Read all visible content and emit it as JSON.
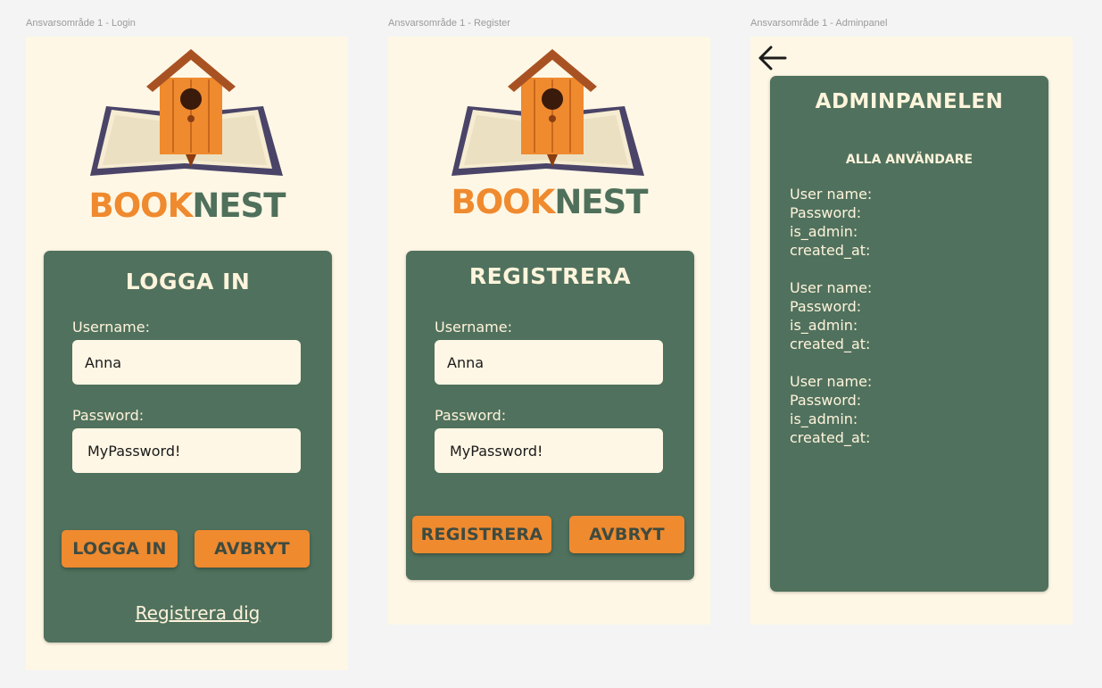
{
  "frames": {
    "login": {
      "label": "Ansvarsområde 1 - Login"
    },
    "register": {
      "label": "Ansvarsområde 1 - Register"
    },
    "admin": {
      "label": "Ansvarsområde 1 - Adminpanel"
    }
  },
  "brand": {
    "part1": "BOOK",
    "part2": "NEST"
  },
  "colors": {
    "background": "#f4f4f4",
    "frame": "#fff7e5",
    "panel": "#50715d",
    "accent": "#ef8a2f",
    "text_light": "#fff4dc"
  },
  "login": {
    "title": "LOGGA IN",
    "username_label": "Username:",
    "username_value": "Anna",
    "password_label": "Password:",
    "password_value": "MyPassword!",
    "login_button": "LOGGA IN",
    "cancel_button": "AVBRYT",
    "register_link": "Registrera dig"
  },
  "register": {
    "title": "REGISTRERA",
    "username_label": "Username:",
    "username_value": "Anna",
    "password_label": "Password:",
    "password_value": "MyPassword!",
    "register_button": "REGISTRERA",
    "cancel_button": "AVBRYT"
  },
  "admin": {
    "back_icon": "arrow-left-icon",
    "title": "ADMINPANELEN",
    "subtitle": "ALLA ANVÄNDARE",
    "users": [
      {
        "username_label": "User name:",
        "password_label": "Password:",
        "is_admin_label": "is_admin:",
        "created_at_label": "created_at:"
      },
      {
        "username_label": "User name:",
        "password_label": "Password:",
        "is_admin_label": "is_admin:",
        "created_at_label": "created_at:"
      },
      {
        "username_label": "User name:",
        "password_label": "Password:",
        "is_admin_label": "is_admin:",
        "created_at_label": "created_at:"
      }
    ]
  }
}
